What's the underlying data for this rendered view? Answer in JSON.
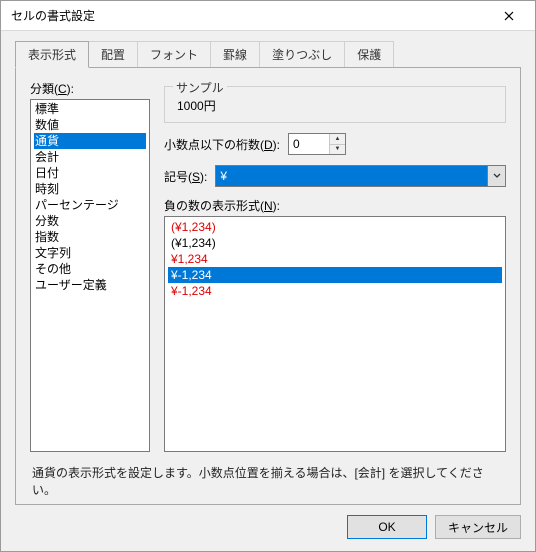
{
  "title": "セルの書式設定",
  "tabs": {
    "display": "表示形式",
    "align": "配置",
    "font": "フォント",
    "border": "罫線",
    "fill": "塗りつぶし",
    "protect": "保護"
  },
  "category": {
    "label_prefix": "分類(",
    "label_key": "C",
    "label_suffix": "):",
    "items": [
      "標準",
      "数値",
      "通貨",
      "会計",
      "日付",
      "時刻",
      "パーセンテージ",
      "分数",
      "指数",
      "文字列",
      "その他",
      "ユーザー定義"
    ],
    "selected": 2
  },
  "sample": {
    "legend": "サンプル",
    "value": "1000円"
  },
  "decimals": {
    "label_prefix": "小数点以下の桁数(",
    "label_key": "D",
    "label_suffix": "):",
    "value": "0"
  },
  "symbol": {
    "label_prefix": "記号(",
    "label_key": "S",
    "label_suffix": "):",
    "value": "¥"
  },
  "neg": {
    "label_prefix": "負の数の表示形式(",
    "label_key": "N",
    "label_suffix": "):",
    "items": [
      {
        "text": "(¥1,234)",
        "cls": "red"
      },
      {
        "text": "(¥1,234)",
        "cls": ""
      },
      {
        "text": "¥1,234",
        "cls": "red"
      },
      {
        "text": "¥-1,234",
        "cls": "selected"
      },
      {
        "text": "¥-1,234",
        "cls": "red"
      }
    ]
  },
  "description": "通貨の表示形式を設定します。小数点位置を揃える場合は、[会計] を選択してください。",
  "buttons": {
    "ok": "OK",
    "cancel": "キャンセル"
  }
}
